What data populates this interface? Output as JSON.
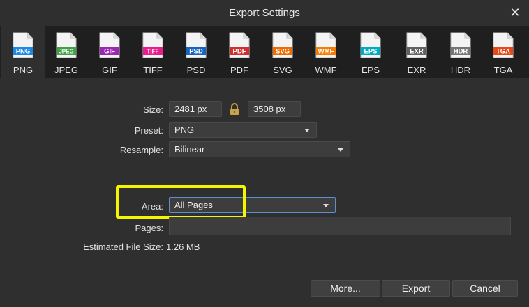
{
  "window": {
    "title": "Export Settings"
  },
  "formats": [
    {
      "tag": "PNG",
      "label": "PNG",
      "color": "#1e88e5"
    },
    {
      "tag": "JPEG",
      "label": "JPEG",
      "color": "#43a047"
    },
    {
      "tag": "GIF",
      "label": "GIF",
      "color": "#9c27b0"
    },
    {
      "tag": "TIFF",
      "label": "TIFF",
      "color": "#e91e8c"
    },
    {
      "tag": "PSD",
      "label": "PSD",
      "color": "#1565c0"
    },
    {
      "tag": "PDF",
      "label": "PDF",
      "color": "#d32f2f"
    },
    {
      "tag": "SVG",
      "label": "SVG",
      "color": "#ef6c00"
    },
    {
      "tag": "WMF",
      "label": "WMF",
      "color": "#f57c00"
    },
    {
      "tag": "EPS",
      "label": "EPS",
      "color": "#00acc1"
    },
    {
      "tag": "EXR",
      "label": "EXR",
      "color": "#616161"
    },
    {
      "tag": "HDR",
      "label": "HDR",
      "color": "#757575"
    },
    {
      "tag": "TGA",
      "label": "TGA",
      "color": "#e64a19"
    }
  ],
  "selected_format": "PNG",
  "form": {
    "size_label": "Size:",
    "width": "2481 px",
    "height": "3508 px",
    "preset_label": "Preset:",
    "preset": "PNG",
    "resample_label": "Resample:",
    "resample": "Bilinear",
    "area_label": "Area:",
    "area": "All Pages",
    "pages_label": "Pages:",
    "pages": "",
    "file_size_label": "Estimated File Size:",
    "file_size": "1.26 MB"
  },
  "buttons": {
    "more": "More...",
    "export": "Export",
    "cancel": "Cancel"
  },
  "colors": {
    "highlight": "#f5f500",
    "dialog_bg": "#2f2f2f",
    "toolbar_bg": "#1f1f1f"
  }
}
